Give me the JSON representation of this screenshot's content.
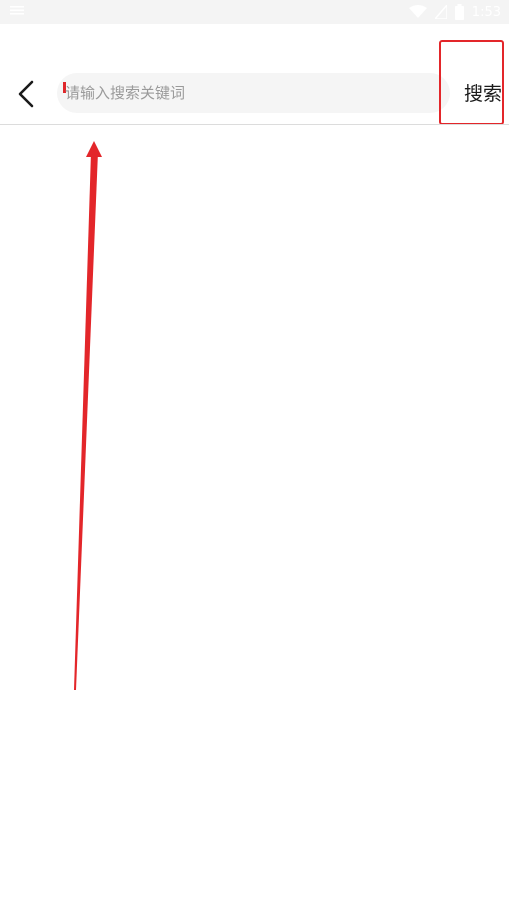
{
  "status_bar": {
    "time": "1:53",
    "icons": [
      "notification-icon",
      "wifi-icon",
      "signal-icon",
      "battery-icon"
    ]
  },
  "search": {
    "placeholder": "请输入搜索关键词",
    "value": ""
  },
  "toolbar": {
    "back_icon": "chevron-left-icon",
    "search_label": "搜索"
  },
  "colors": {
    "annotation": "#e3262a",
    "search_box_bg": "#f5f5f5",
    "placeholder": "#9a9a9a",
    "status_bar_bg": "#f4f4f4"
  }
}
